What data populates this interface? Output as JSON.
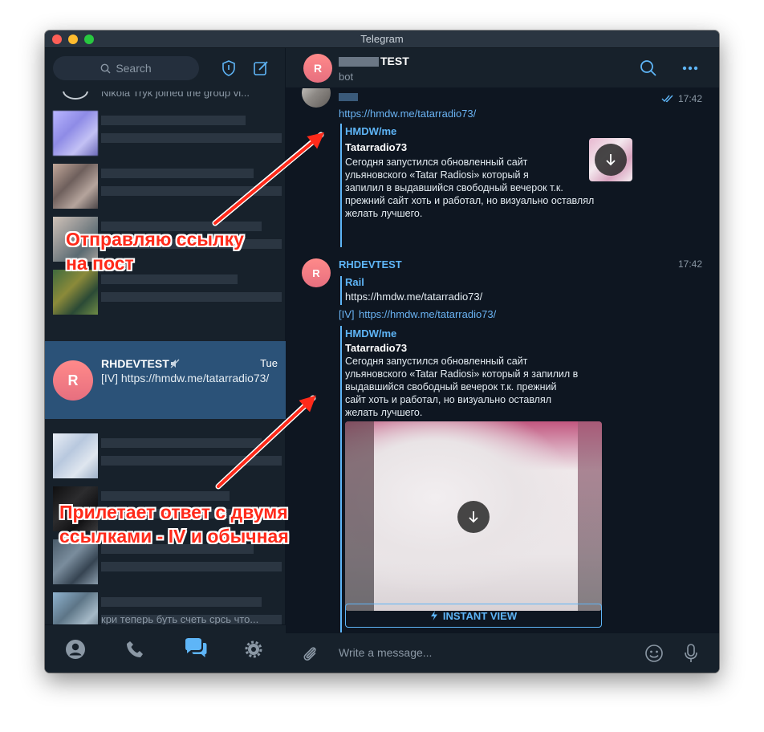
{
  "window": {
    "title": "Telegram"
  },
  "sidebar": {
    "search_placeholder": "Search",
    "partial_top_text": "Nikola Tryk joined the group vi...",
    "active_chat": {
      "avatar_letter": "R",
      "name": "RHDEVTEST",
      "time": "Tue",
      "preview": "[IV] https://hmdw.me/tatarradio73/"
    },
    "partial_bottom_text": "кри теперь буть счеть срсь что..."
  },
  "chat": {
    "header": {
      "avatar_letter": "R",
      "title_suffix": "TEST",
      "subtitle": "bot"
    },
    "messages": [
      {
        "time": "17:42",
        "link": "https://hmdw.me/tatarradio73/",
        "preview": {
          "site": "HMDW/me",
          "title": "Tatarradio73",
          "description": [
            "Сегодня запустился обновленный сайт",
            "ульяновского «Tatar Radiosi» который я",
            "запилил в выдавшийся свободный вечерок т.к.",
            "прежний сайт хоть и работал, но визуально оставлял",
            "желать лучшего."
          ]
        }
      },
      {
        "avatar_letter": "R",
        "sender": "RHDEVTEST",
        "time": "17:42",
        "reply": {
          "author": "Rail",
          "text": "https://hmdw.me/tatarradio73/"
        },
        "iv_prefix": "[IV]",
        "link": "https://hmdw.me/tatarradio73/",
        "preview": {
          "site": "HMDW/me",
          "title": "Tatarradio73",
          "description": [
            "Сегодня запустился обновленный сайт",
            "ульяновского «Tatar Radiosi» который я запилил в",
            "выдавшийся свободный вечерок т.к. прежний",
            "сайт хоть и работал, но визуально оставлял",
            "желать лучшего."
          ]
        },
        "instant_view_label": "INSTANT VIEW"
      }
    ],
    "composer_placeholder": "Write a message..."
  },
  "annotations": {
    "first": [
      "Отправляю ссылку",
      "на пост"
    ],
    "second": [
      "Прилетает ответ с двумя",
      "ссылками - IV и обычная"
    ]
  },
  "colors": {
    "accent": "#5eb5f7",
    "link": "#6ab3f3",
    "active_row": "#2b5278",
    "annotation_red": "#ff2a1a"
  },
  "icons": [
    "search-icon",
    "shield-icon",
    "compose-icon",
    "double-check-icon",
    "download-icon",
    "lightning-icon",
    "paperclip-icon",
    "emoji-icon",
    "microphone-icon",
    "profile-icon",
    "phone-icon",
    "chats-icon",
    "settings-icon",
    "muted-icon",
    "more-icon"
  ]
}
